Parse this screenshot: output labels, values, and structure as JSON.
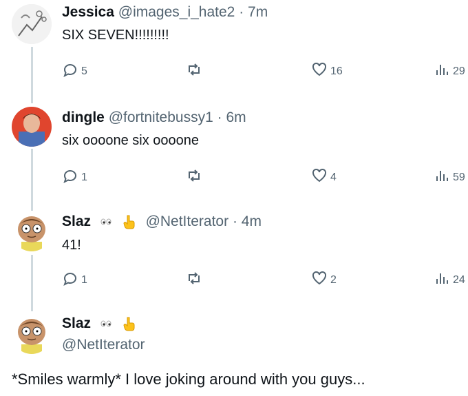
{
  "tweets": [
    {
      "name": "Jessica",
      "handle": "@images_i_hate2",
      "separator": "·",
      "time": "7m",
      "text": "SIX SEVEN!!!!!!!!!",
      "replies": "5",
      "likes": "16",
      "views": "29"
    },
    {
      "name": "dingle",
      "handle": "@fortnitebussy1",
      "separator": "·",
      "time": "6m",
      "text": "six oooone six oooone",
      "replies": "1",
      "likes": "4",
      "views": "59"
    },
    {
      "name": "Slaz",
      "handle": "@NetIterator",
      "separator": "·",
      "time": "4m",
      "text": "41!",
      "replies": "1",
      "likes": "2",
      "views": "24"
    }
  ],
  "final": {
    "name": "Slaz",
    "handle": "@NetIterator",
    "text": "*Smiles warmly* I love joking around with you guys..."
  },
  "icons": [
    "reply-icon",
    "retweet-icon",
    "like-icon",
    "views-icon",
    "eyes-emoji-icon",
    "pointing-finger-emoji-icon"
  ]
}
